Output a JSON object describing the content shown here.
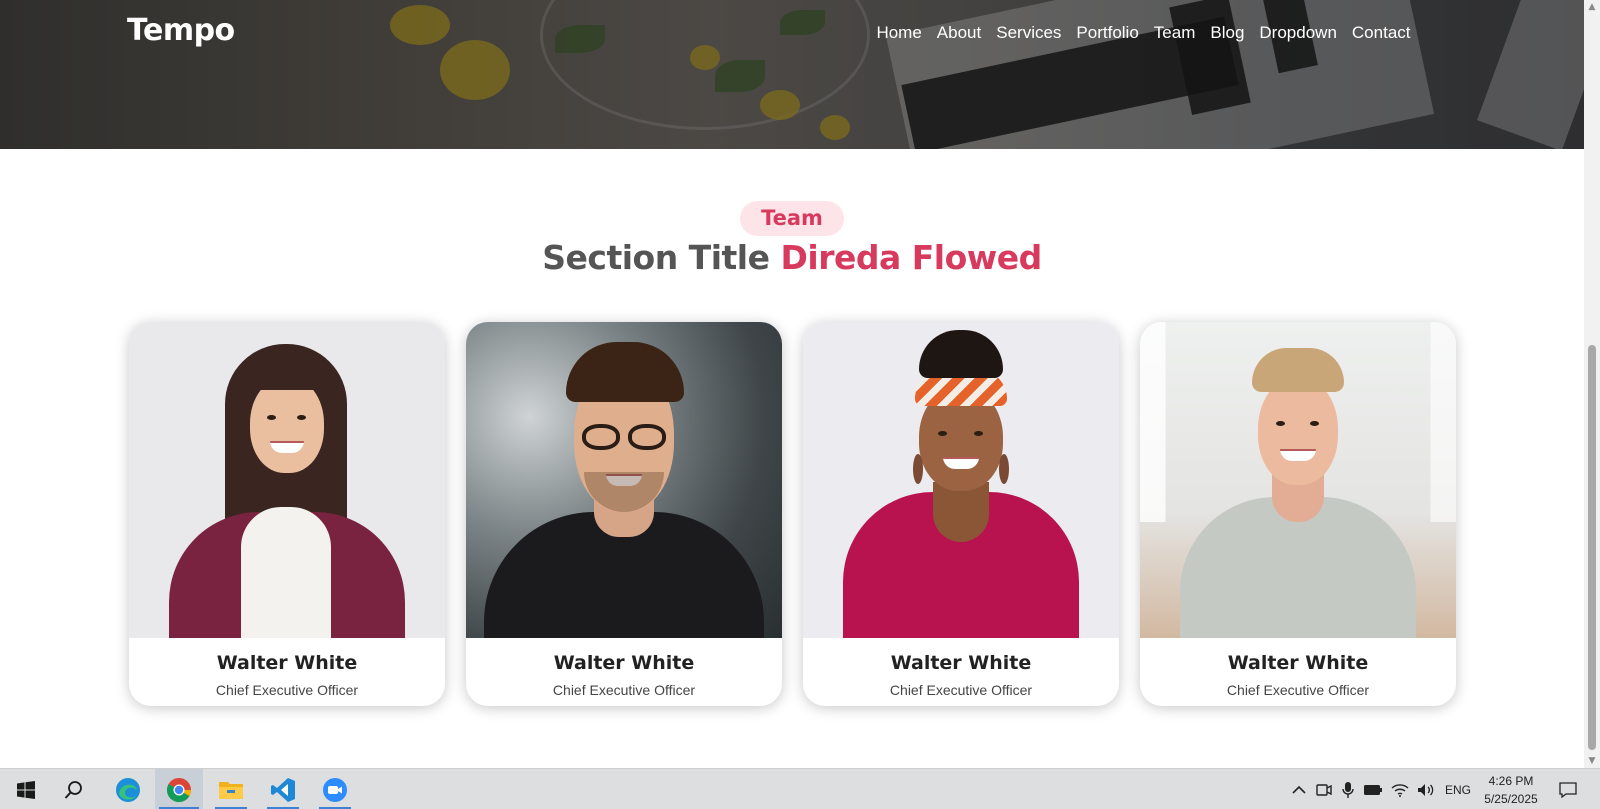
{
  "site": {
    "logo": "Tempo",
    "nav": [
      "Home",
      "About",
      "Services",
      "Portfolio",
      "Team",
      "Blog",
      "Dropdown",
      "Contact"
    ]
  },
  "section": {
    "badge": "Team",
    "title_main": "Section Title",
    "title_accent": "Direda Flowed",
    "accent_color": "#d83a5e"
  },
  "team": [
    {
      "name": "Walter White",
      "role": "Chief Executive Officer"
    },
    {
      "name": "Walter White",
      "role": "Chief Executive Officer"
    },
    {
      "name": "Walter White",
      "role": "Chief Executive Officer"
    },
    {
      "name": "Walter White",
      "role": "Chief Executive Officer"
    }
  ],
  "taskbar": {
    "apps": [
      "start-icon",
      "search-icon",
      "edge-icon",
      "chrome-icon",
      "file-explorer-icon",
      "vscode-icon",
      "zoom-icon"
    ],
    "language": "ENG",
    "time": "4:26 PM",
    "date": "5/25/2025"
  }
}
